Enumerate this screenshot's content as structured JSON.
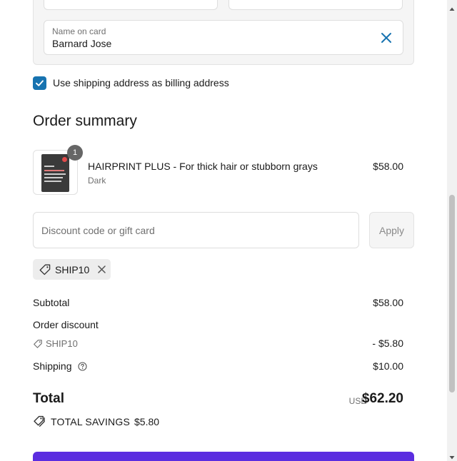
{
  "card": {
    "name_label": "Name on card",
    "name_value": "Barnard Jose"
  },
  "billing": {
    "same_as_shipping_label": "Use shipping address as billing address",
    "checked": true
  },
  "summary": {
    "title": "Order summary",
    "item": {
      "name": "HAIRPRINT PLUS - For thick hair or stubborn grays",
      "variant": "Dark",
      "price": "$58.00",
      "quantity": "1"
    }
  },
  "discount": {
    "placeholder": "Discount code or gift card",
    "apply_label": "Apply",
    "applied_code": "SHIP10"
  },
  "totals": {
    "subtotal_label": "Subtotal",
    "subtotal_value": "$58.00",
    "discount_label": "Order discount",
    "discount_code": "SHIP10",
    "discount_value": "- $5.80",
    "shipping_label": "Shipping",
    "shipping_value": "$10.00",
    "total_label": "Total",
    "currency": "USD",
    "total_value": "$62.20",
    "savings_label": "TOTAL SAVINGS",
    "savings_value": "$5.80"
  },
  "colors": {
    "accent": "#1773b0",
    "pay_button": "#5b2de0",
    "muted_text": "#707070"
  },
  "icons": [
    "close-icon",
    "check-icon",
    "tag-icon",
    "help-icon",
    "tags-icon",
    "scroll-up-icon",
    "scroll-down-icon"
  ]
}
